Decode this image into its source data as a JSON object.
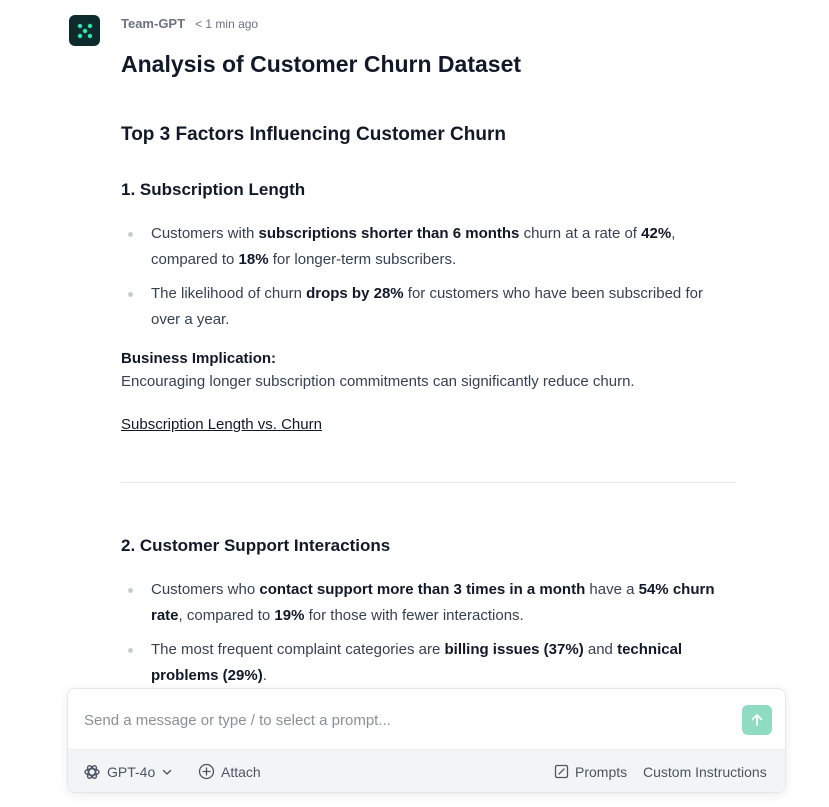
{
  "message": {
    "author": "Team-GPT",
    "timestamp": "< 1 min ago",
    "title": "Analysis of Customer Churn Dataset",
    "section_title": "Top 3 Factors Influencing Customer Churn",
    "factor1": {
      "title": "1. Subscription Length",
      "bullet1": {
        "t1": "Customers with ",
        "b1": "subscriptions shorter than 6 months",
        "t2": " churn at a rate of ",
        "b2": "42%",
        "t3": ", compared to ",
        "b3": "18%",
        "t4": " for longer-term subscribers."
      },
      "bullet2": {
        "t1": "The likelihood of churn ",
        "b1": "drops by 28%",
        "t2": " for customers who have been subscribed for over a year."
      },
      "implication_label": "Business Implication:",
      "implication_text": "Encouraging longer subscription commitments can significantly reduce churn.",
      "link": "Subscription Length vs. Churn"
    },
    "factor2": {
      "title": "2. Customer Support Interactions",
      "bullet1": {
        "t1": "Customers who ",
        "b1": "contact support more than 3 times in a month",
        "t2": " have a ",
        "b2": "54% churn rate",
        "t3": ", compared to ",
        "b3": "19%",
        "t4": " for those with fewer interactions."
      },
      "bullet2": {
        "t1": "The most frequent complaint categories are ",
        "b1": "billing issues (37%)",
        "t2": " and ",
        "b2": "technical problems (29%)",
        "t3": "."
      }
    }
  },
  "composer": {
    "placeholder": "Send a message or type / to select a prompt...",
    "model": "GPT-4o",
    "attach": "Attach",
    "prompts": "Prompts",
    "custom_instructions": "Custom Instructions"
  },
  "colors": {
    "avatar_bg": "#0f2a2c",
    "avatar_accent": "#2ee6a8",
    "send_button": "#8fdcc2"
  },
  "icons": {
    "avatar": "team-gpt-logo",
    "send": "arrow-up-icon",
    "model": "openai-icon",
    "model_dropdown": "chevron-down-icon",
    "attach": "plus-circle-icon",
    "prompts": "edit-square-icon"
  }
}
